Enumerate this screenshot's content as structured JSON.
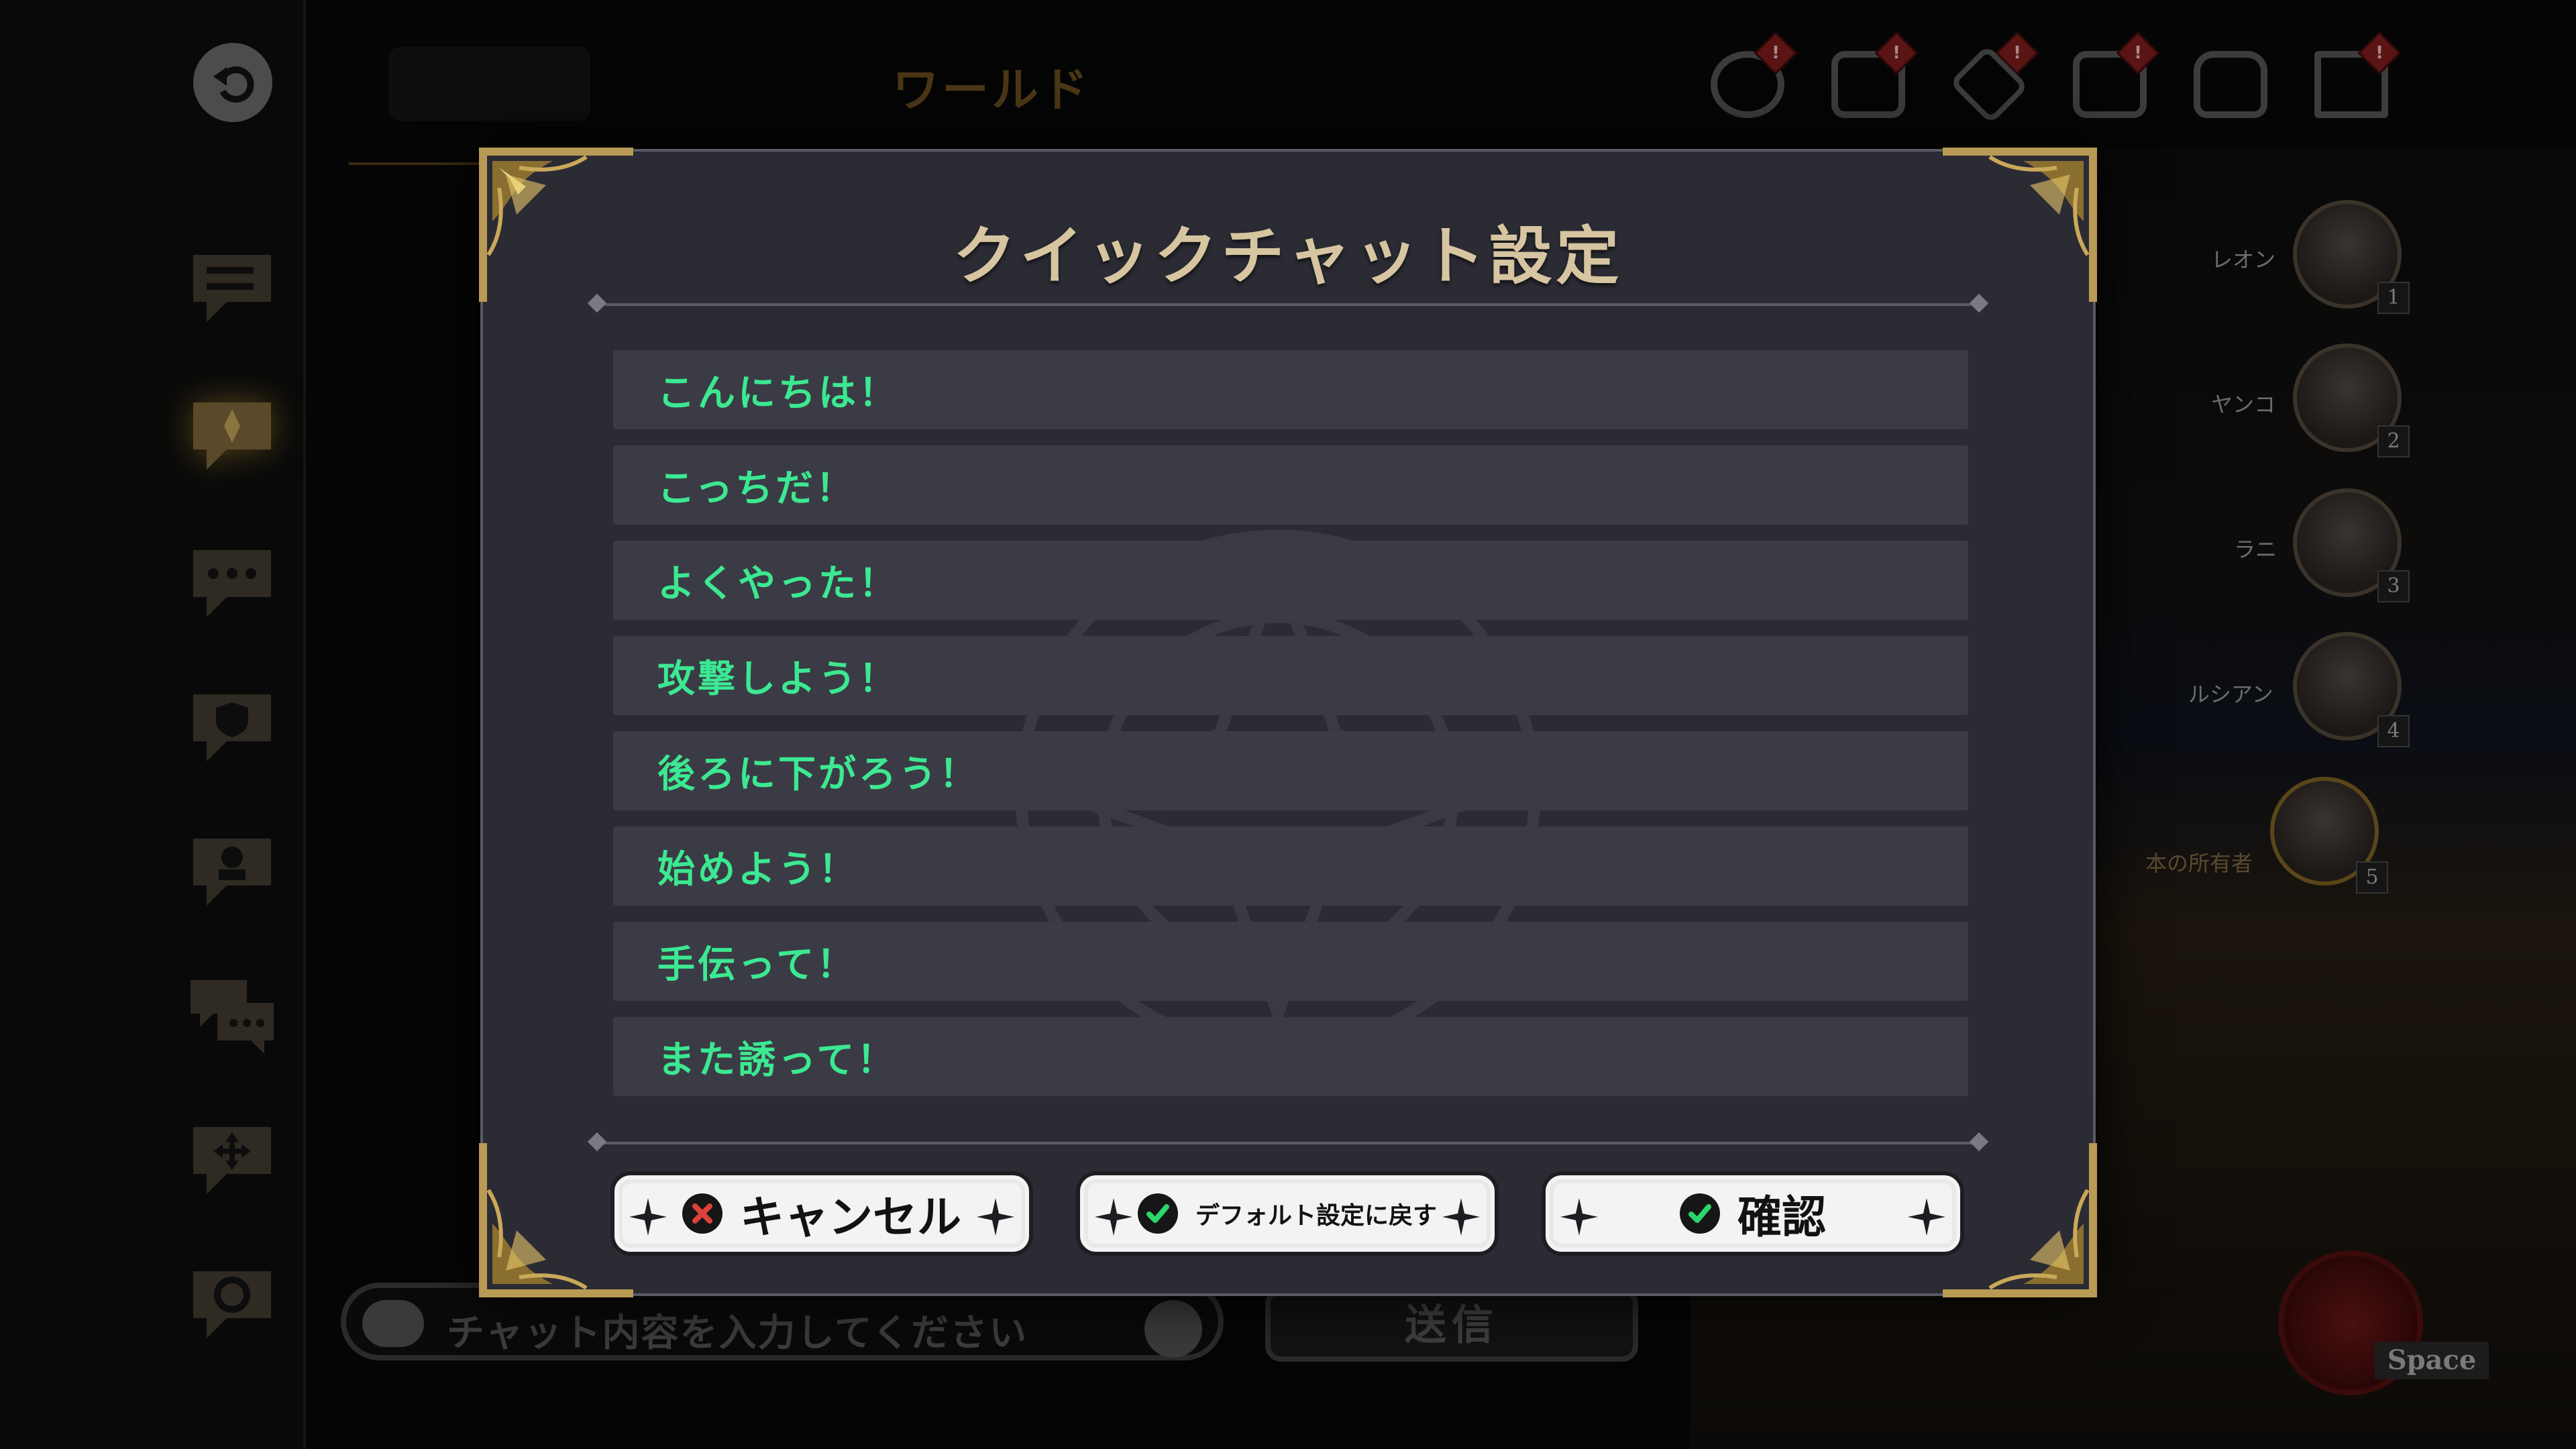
{
  "background": {
    "world_title": "ワールド",
    "chat_placeholder": "チャット内容を入力してください",
    "send_label": "送信",
    "space_label": "Space",
    "top_icon_badge": "!",
    "party": [
      {
        "name": "レオン",
        "number": "1"
      },
      {
        "name": "ヤンコ",
        "number": "2"
      },
      {
        "name": "ラニ",
        "number": "3"
      },
      {
        "name": "ルシアン",
        "number": "4"
      },
      {
        "name": "本の所有者",
        "number": "5"
      }
    ]
  },
  "modal": {
    "title": "クイックチャット設定",
    "messages": [
      "こんにちは！",
      "こっちだ！",
      "よくやった！",
      "攻撃しよう！",
      "後ろに下がろう！",
      "始めよう！",
      "手伝って！",
      "また誘って！"
    ],
    "buttons": {
      "cancel": "キャンセル",
      "reset": "デフォルト設定に戻す",
      "confirm": "確認"
    }
  },
  "colors": {
    "message_text": "#3ce891",
    "title_gold": "#d6c5a0",
    "cancel_icon": "#e0403a",
    "confirm_icon": "#2bd66a"
  }
}
